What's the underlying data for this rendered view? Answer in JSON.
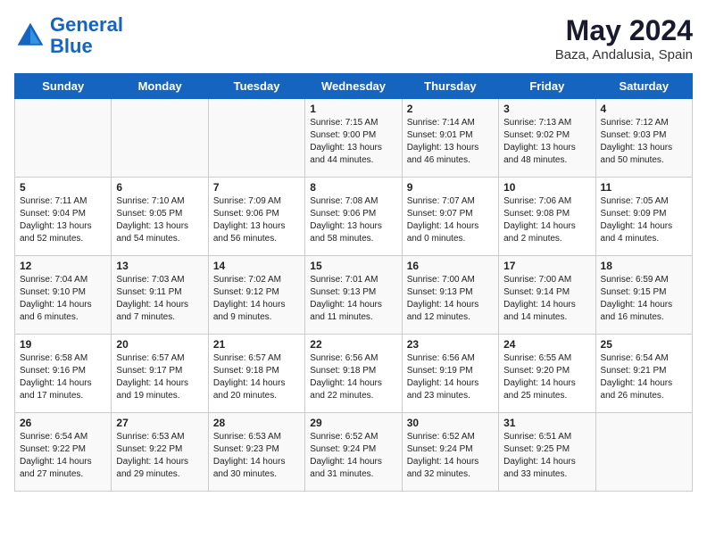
{
  "header": {
    "logo_line1": "General",
    "logo_line2": "Blue",
    "month": "May 2024",
    "location": "Baza, Andalusia, Spain"
  },
  "days_of_week": [
    "Sunday",
    "Monday",
    "Tuesday",
    "Wednesday",
    "Thursday",
    "Friday",
    "Saturday"
  ],
  "weeks": [
    [
      {
        "day": "",
        "info": ""
      },
      {
        "day": "",
        "info": ""
      },
      {
        "day": "",
        "info": ""
      },
      {
        "day": "1",
        "info": "Sunrise: 7:15 AM\nSunset: 9:00 PM\nDaylight: 13 hours\nand 44 minutes."
      },
      {
        "day": "2",
        "info": "Sunrise: 7:14 AM\nSunset: 9:01 PM\nDaylight: 13 hours\nand 46 minutes."
      },
      {
        "day": "3",
        "info": "Sunrise: 7:13 AM\nSunset: 9:02 PM\nDaylight: 13 hours\nand 48 minutes."
      },
      {
        "day": "4",
        "info": "Sunrise: 7:12 AM\nSunset: 9:03 PM\nDaylight: 13 hours\nand 50 minutes."
      }
    ],
    [
      {
        "day": "5",
        "info": "Sunrise: 7:11 AM\nSunset: 9:04 PM\nDaylight: 13 hours\nand 52 minutes."
      },
      {
        "day": "6",
        "info": "Sunrise: 7:10 AM\nSunset: 9:05 PM\nDaylight: 13 hours\nand 54 minutes."
      },
      {
        "day": "7",
        "info": "Sunrise: 7:09 AM\nSunset: 9:06 PM\nDaylight: 13 hours\nand 56 minutes."
      },
      {
        "day": "8",
        "info": "Sunrise: 7:08 AM\nSunset: 9:06 PM\nDaylight: 13 hours\nand 58 minutes."
      },
      {
        "day": "9",
        "info": "Sunrise: 7:07 AM\nSunset: 9:07 PM\nDaylight: 14 hours\nand 0 minutes."
      },
      {
        "day": "10",
        "info": "Sunrise: 7:06 AM\nSunset: 9:08 PM\nDaylight: 14 hours\nand 2 minutes."
      },
      {
        "day": "11",
        "info": "Sunrise: 7:05 AM\nSunset: 9:09 PM\nDaylight: 14 hours\nand 4 minutes."
      }
    ],
    [
      {
        "day": "12",
        "info": "Sunrise: 7:04 AM\nSunset: 9:10 PM\nDaylight: 14 hours\nand 6 minutes."
      },
      {
        "day": "13",
        "info": "Sunrise: 7:03 AM\nSunset: 9:11 PM\nDaylight: 14 hours\nand 7 minutes."
      },
      {
        "day": "14",
        "info": "Sunrise: 7:02 AM\nSunset: 9:12 PM\nDaylight: 14 hours\nand 9 minutes."
      },
      {
        "day": "15",
        "info": "Sunrise: 7:01 AM\nSunset: 9:13 PM\nDaylight: 14 hours\nand 11 minutes."
      },
      {
        "day": "16",
        "info": "Sunrise: 7:00 AM\nSunset: 9:13 PM\nDaylight: 14 hours\nand 12 minutes."
      },
      {
        "day": "17",
        "info": "Sunrise: 7:00 AM\nSunset: 9:14 PM\nDaylight: 14 hours\nand 14 minutes."
      },
      {
        "day": "18",
        "info": "Sunrise: 6:59 AM\nSunset: 9:15 PM\nDaylight: 14 hours\nand 16 minutes."
      }
    ],
    [
      {
        "day": "19",
        "info": "Sunrise: 6:58 AM\nSunset: 9:16 PM\nDaylight: 14 hours\nand 17 minutes."
      },
      {
        "day": "20",
        "info": "Sunrise: 6:57 AM\nSunset: 9:17 PM\nDaylight: 14 hours\nand 19 minutes."
      },
      {
        "day": "21",
        "info": "Sunrise: 6:57 AM\nSunset: 9:18 PM\nDaylight: 14 hours\nand 20 minutes."
      },
      {
        "day": "22",
        "info": "Sunrise: 6:56 AM\nSunset: 9:18 PM\nDaylight: 14 hours\nand 22 minutes."
      },
      {
        "day": "23",
        "info": "Sunrise: 6:56 AM\nSunset: 9:19 PM\nDaylight: 14 hours\nand 23 minutes."
      },
      {
        "day": "24",
        "info": "Sunrise: 6:55 AM\nSunset: 9:20 PM\nDaylight: 14 hours\nand 25 minutes."
      },
      {
        "day": "25",
        "info": "Sunrise: 6:54 AM\nSunset: 9:21 PM\nDaylight: 14 hours\nand 26 minutes."
      }
    ],
    [
      {
        "day": "26",
        "info": "Sunrise: 6:54 AM\nSunset: 9:22 PM\nDaylight: 14 hours\nand 27 minutes."
      },
      {
        "day": "27",
        "info": "Sunrise: 6:53 AM\nSunset: 9:22 PM\nDaylight: 14 hours\nand 29 minutes."
      },
      {
        "day": "28",
        "info": "Sunrise: 6:53 AM\nSunset: 9:23 PM\nDaylight: 14 hours\nand 30 minutes."
      },
      {
        "day": "29",
        "info": "Sunrise: 6:52 AM\nSunset: 9:24 PM\nDaylight: 14 hours\nand 31 minutes."
      },
      {
        "day": "30",
        "info": "Sunrise: 6:52 AM\nSunset: 9:24 PM\nDaylight: 14 hours\nand 32 minutes."
      },
      {
        "day": "31",
        "info": "Sunrise: 6:51 AM\nSunset: 9:25 PM\nDaylight: 14 hours\nand 33 minutes."
      },
      {
        "day": "",
        "info": ""
      }
    ]
  ]
}
